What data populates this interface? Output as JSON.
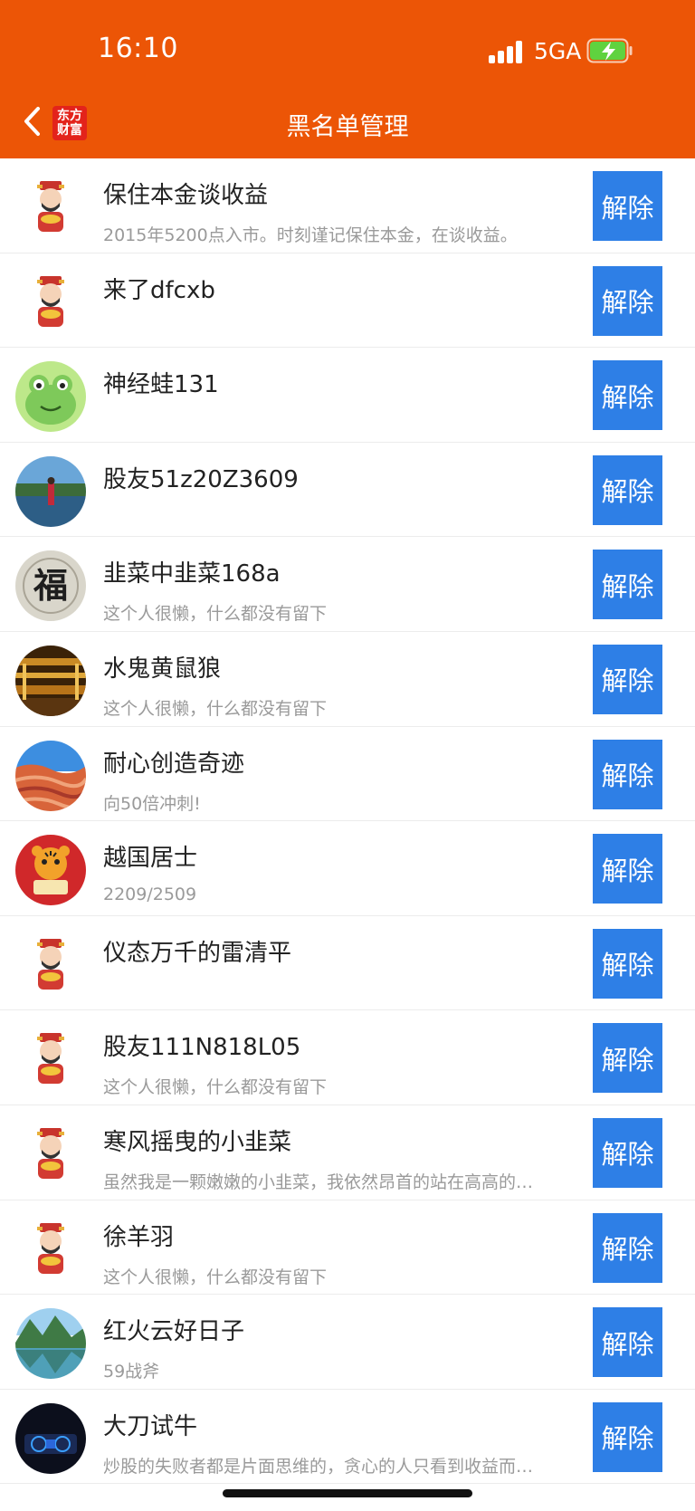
{
  "status_bar": {
    "time": "16:10",
    "network": "5GA"
  },
  "header": {
    "title": "黑名单管理",
    "logo_line1": "东方",
    "logo_line2": "财富"
  },
  "colors": {
    "header_bg": "#ec5506",
    "button_bg": "#2e7fe6"
  },
  "list": {
    "items": [
      {
        "name": "保住本金谈收益",
        "desc": "2015年5200点入市。时刻谨记保住本金，在谈收益。",
        "avatar": "god-of-wealth",
        "button": "解除"
      },
      {
        "name": "来了dfcxb",
        "desc": "",
        "avatar": "god-of-wealth",
        "button": "解除"
      },
      {
        "name": "神经蛙131",
        "desc": "",
        "avatar": "frog",
        "button": "解除"
      },
      {
        "name": "股友51z20Z3609",
        "desc": "",
        "avatar": "lake-photo",
        "button": "解除"
      },
      {
        "name": "韭菜中韭菜168a",
        "desc": "这个人很懒，什么都没有留下",
        "avatar": "fu-calligraphy",
        "button": "解除"
      },
      {
        "name": "水鬼黄鼠狼",
        "desc": "这个人很懒，什么都没有留下",
        "avatar": "palace-hall",
        "button": "解除"
      },
      {
        "name": "耐心创造奇迹",
        "desc": "向50倍冲刺!",
        "avatar": "red-rock",
        "button": "解除"
      },
      {
        "name": "越国居士",
        "desc": "2209/2509",
        "avatar": "tiger",
        "button": "解除"
      },
      {
        "name": "仪态万千的雷清平",
        "desc": "",
        "avatar": "god-of-wealth",
        "button": "解除"
      },
      {
        "name": "股友111N818L05",
        "desc": "这个人很懒，什么都没有留下",
        "avatar": "god-of-wealth",
        "button": "解除"
      },
      {
        "name": "寒风摇曳的小韭菜",
        "desc": "虽然我是一颗嫩嫩的小韭菜，我依然昂首的站在高高的…",
        "avatar": "god-of-wealth",
        "button": "解除"
      },
      {
        "name": "徐羊羽",
        "desc": "这个人很懒，什么都没有留下",
        "avatar": "god-of-wealth",
        "button": "解除"
      },
      {
        "name": "红火云好日子",
        "desc": "59战斧",
        "avatar": "mountain-lake",
        "button": "解除"
      },
      {
        "name": "大刀试牛",
        "desc": "炒股的失败者都是片面思维的，贪心的人只看到收益而…",
        "avatar": "car-dashboard",
        "button": "解除"
      }
    ]
  }
}
